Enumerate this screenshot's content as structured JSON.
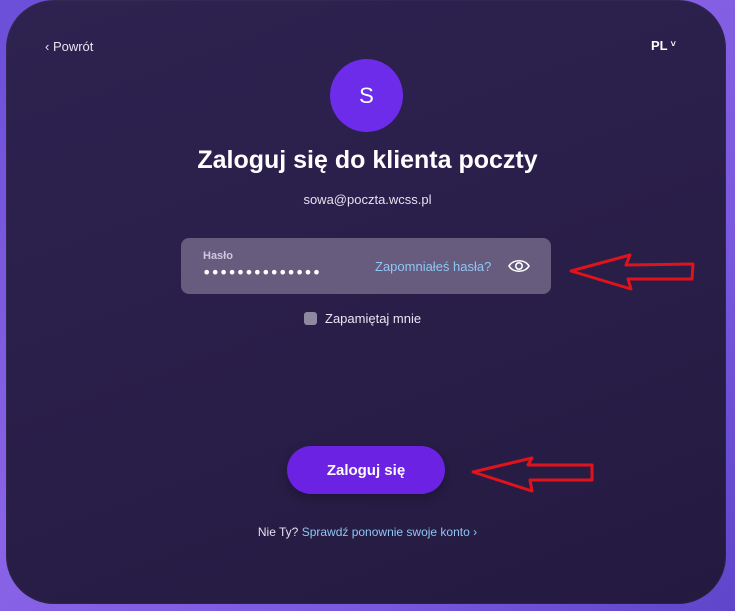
{
  "header": {
    "back_label": "‹ Powrót",
    "language": "PL",
    "language_chevron": "˅"
  },
  "account": {
    "avatar_initial": "S",
    "title": "Zaloguj się do klienta poczty",
    "email": "sowa@poczta.wcss.pl"
  },
  "password": {
    "label": "Hasło",
    "masked_value": "••••••••••••••",
    "forgot_link": "Zapomniałeś hasła?",
    "show_icon": "eye-icon"
  },
  "remember": {
    "label": "Zapamiętaj mnie",
    "checked": false
  },
  "login_button": {
    "label": "Zaloguj się"
  },
  "footer": {
    "prefix": "Nie Ty?",
    "link": "Sprawdź ponownie swoje konto ›"
  },
  "colors": {
    "accent": "#6b22e3",
    "link": "#8ec7f5",
    "annotation_arrow": "#e0131b"
  }
}
